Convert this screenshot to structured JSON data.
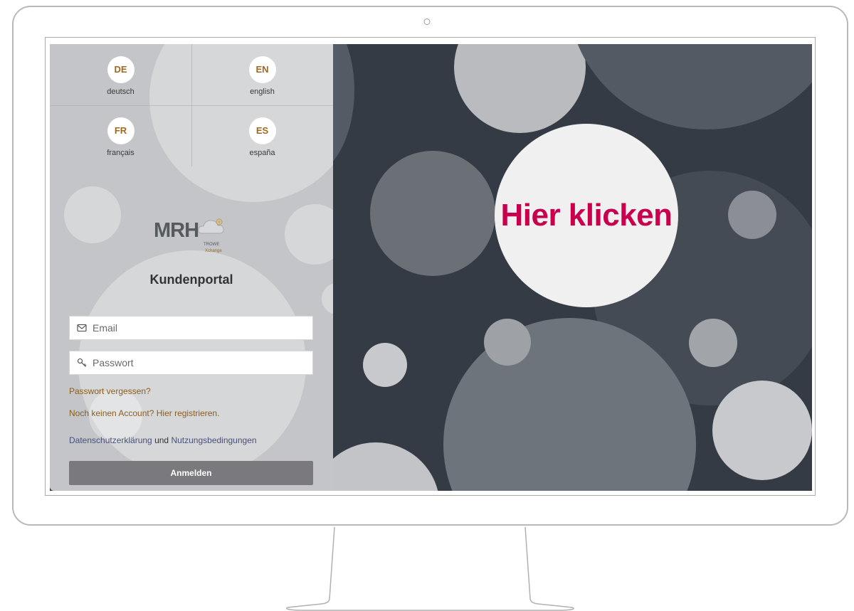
{
  "languages": [
    {
      "code": "DE",
      "label": "deutsch"
    },
    {
      "code": "EN",
      "label": "english"
    },
    {
      "code": "FR",
      "label": "français"
    },
    {
      "code": "ES",
      "label": "españa"
    }
  ],
  "logo": {
    "main": "MRH",
    "sub": "TROWE",
    "sub2": "Xchange"
  },
  "portal_title": "Kundenportal",
  "form": {
    "email_placeholder": "Email",
    "password_placeholder": "Passwort",
    "forgot_password": "Passwort vergessen?",
    "register": "Noch keinen Account? Hier registrieren.",
    "privacy_link": "Datenschutzerklärung",
    "and": "und",
    "terms_link": "Nutzungsbedingungen",
    "login_button": "Anmelden"
  },
  "cta": {
    "label": "Hier klicken"
  },
  "colors": {
    "accent_gold": "#a0681e",
    "cta_red": "#c8004e",
    "background_dark": "#343b45"
  },
  "icons": {
    "email": "envelope-icon",
    "password": "key-icon",
    "camera": "camera-icon"
  }
}
